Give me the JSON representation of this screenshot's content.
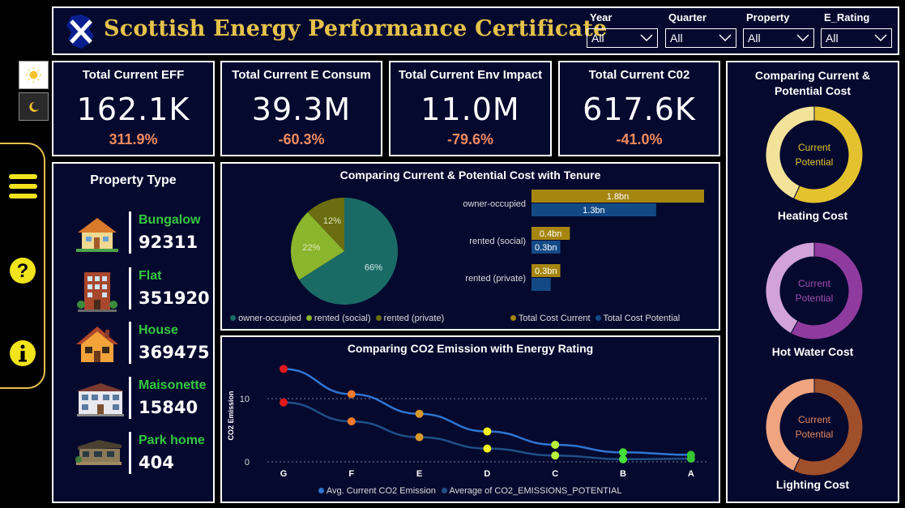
{
  "header": {
    "title": "Scottish Energy Performance Certificate",
    "filters": [
      {
        "label": "Year",
        "value": "All"
      },
      {
        "label": "Quarter",
        "value": "All"
      },
      {
        "label": "Property",
        "value": "All"
      },
      {
        "label": "E_Rating",
        "value": "All"
      }
    ],
    "colors": {
      "title": "#e6c24a",
      "panel": "#05092e",
      "accent_green": "#34c940",
      "accent_orange": "#f08a5d"
    }
  },
  "sidebar": {
    "theme_buttons": [
      "sun-icon",
      "moon-icon"
    ],
    "nav_icons": [
      "menu-icon",
      "help-icon",
      "info-icon"
    ]
  },
  "kpis": [
    {
      "title": "Total Current EFF",
      "value": "162.1K",
      "change": "311.9%"
    },
    {
      "title": "Total Current E Consum",
      "value": "39.3M",
      "change": "-60.3%"
    },
    {
      "title": "Total Current Env Impact",
      "value": "11.0M",
      "change": "-79.6%"
    },
    {
      "title": "Total Current C02",
      "value": "617.6K",
      "change": "-41.0%"
    }
  ],
  "property_type": {
    "title": "Property Type",
    "items": [
      {
        "name": "Bungalow",
        "count": "92311",
        "icon": "bungalow-icon"
      },
      {
        "name": "Flat",
        "count": "351920",
        "icon": "flat-icon"
      },
      {
        "name": "House",
        "count": "369475",
        "icon": "house-icon"
      },
      {
        "name": "Maisonette",
        "count": "15840",
        "icon": "maisonette-icon"
      },
      {
        "name": "Park home",
        "count": "404",
        "icon": "park-home-icon"
      }
    ]
  },
  "tenure_chart": {
    "title": "Comparing Current & Potential Cost with Tenure",
    "pie_legend": [
      "owner-occupied",
      "rented (social)",
      "rented (private)"
    ],
    "bar_legend": [
      "Total Cost Current",
      "Total Cost Potential"
    ]
  },
  "co2_chart": {
    "title": "Comparing CO2 Emission with Energy Rating",
    "ylabel": "CO2 Emission",
    "legend": [
      "Avg. Current CO2 Emission",
      "Average of CO2_EMISSIONS_POTENTIAL"
    ]
  },
  "cost_panel": {
    "title_line1": "Comparing Current &",
    "title_line2": "Potential Cost",
    "donuts": [
      {
        "label": "Heating Cost",
        "current_label": "Current",
        "potential_label": "Potential",
        "current_share": 0.57,
        "color_main": "#e4c22f",
        "color_light": "#f3e29a",
        "text_color": "#e4c22f"
      },
      {
        "label": "Hot Water Cost",
        "current_label": "Current",
        "potential_label": "Potential",
        "current_share": 0.58,
        "color_main": "#8f3b9e",
        "color_light": "#d2a3d8",
        "text_color": "#a04cb0"
      },
      {
        "label": "Lighting Cost",
        "current_label": "Current",
        "potential_label": "Potential",
        "current_share": 0.57,
        "color_main": "#a04f2b",
        "color_light": "#f0a47f",
        "text_color": "#e0865d"
      }
    ]
  },
  "chart_data": [
    {
      "type": "pie",
      "title": "Comparing Current & Potential Cost with Tenure",
      "categories": [
        "owner-occupied",
        "rented (social)",
        "rented (private)"
      ],
      "values": [
        66,
        22,
        12
      ],
      "labels": [
        "66%",
        "22%",
        "12%"
      ],
      "colors": [
        "#1a6b66",
        "#8cb52e",
        "#6b6e10"
      ],
      "legend_position": "bottom-left"
    },
    {
      "type": "bar",
      "orientation": "horizontal",
      "categories": [
        "owner-occupied",
        "rented (social)",
        "rented (private)"
      ],
      "series": [
        {
          "name": "Total Cost Current",
          "values": [
            1.8,
            0.4,
            0.3
          ],
          "labels": [
            "1.8bn",
            "0.4bn",
            "0.3bn"
          ],
          "color": "#a6860f"
        },
        {
          "name": "Total Cost Potential",
          "values": [
            1.3,
            0.3,
            0.2
          ],
          "labels": [
            "1.3bn",
            "0.3bn",
            ""
          ],
          "color": "#134a86"
        }
      ],
      "xlim": [
        0,
        1.8
      ],
      "legend_position": "bottom"
    },
    {
      "type": "line",
      "title": "Comparing CO2 Emission with Energy Rating",
      "categories": [
        "G",
        "F",
        "E",
        "D",
        "C",
        "B",
        "A"
      ],
      "ylabel": "CO2 Emission",
      "ylim": [
        0,
        15
      ],
      "yticks": [
        0,
        10
      ],
      "grid": true,
      "series": [
        {
          "name": "Avg. Current CO2 Emission",
          "values": [
            14.7,
            10.7,
            7.6,
            4.8,
            2.7,
            1.5,
            1.1
          ],
          "color": "#2f74d0"
        },
        {
          "name": "Average of CO2_EMISSIONS_POTENTIAL",
          "values": [
            9.4,
            6.4,
            3.9,
            2.1,
            1.0,
            0.4,
            0.5
          ],
          "color": "#1f4f86"
        }
      ],
      "marker_colors": [
        "#e0191b",
        "#f07a2a",
        "#d99a2c",
        "#f2f21c",
        "#b8f23a",
        "#45e03a",
        "#35c635"
      ],
      "legend_position": "bottom"
    }
  ]
}
